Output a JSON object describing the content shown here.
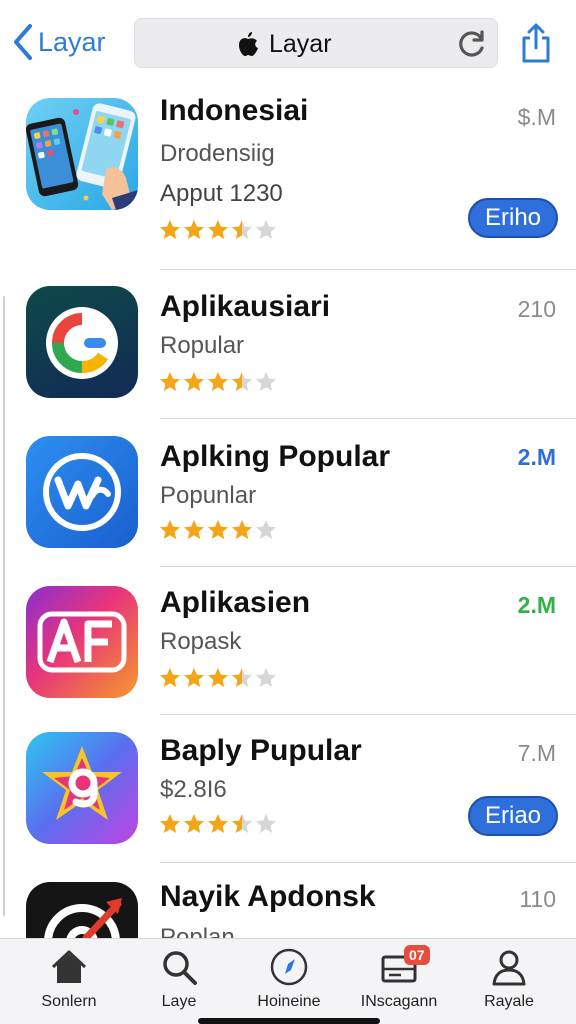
{
  "nav": {
    "back_label": "Layar",
    "address_text": "Layar"
  },
  "apps": [
    {
      "title": "Indonesiai",
      "subtitle": "Drodensiig",
      "subtitle2": "Apput 1230",
      "meta": "$.M",
      "meta_color": "#8a8a8e",
      "rating": 3.5,
      "button": "Eriho"
    },
    {
      "title": "Aplikausiari",
      "subtitle": "Ropular",
      "meta": "210",
      "meta_color": "#8a8a8e",
      "rating": 3.5
    },
    {
      "title": "Aplking Popular",
      "subtitle": "Popunlar",
      "meta": "2.M",
      "meta_color": "#2f6fdc",
      "rating": 4
    },
    {
      "title": "Aplikasien",
      "subtitle": "Ropask",
      "meta": "2.M",
      "meta_color": "#2fb24a",
      "rating": 3.5
    },
    {
      "title": "Baply Pupular",
      "subtitle": "$2.8I6",
      "meta": "7.M",
      "meta_color": "#8a8a8e",
      "rating": 3.5,
      "button": "Eriao"
    },
    {
      "title": "Nayik Apdonsk",
      "subtitle": "Poplan",
      "meta": "110",
      "meta_color": "#8a8a8e",
      "rating": 0
    }
  ],
  "tabs": [
    {
      "label": "Sonlern",
      "icon": "home-icon"
    },
    {
      "label": "Laye",
      "icon": "search-icon"
    },
    {
      "label": "Hoineine",
      "icon": "compass-icon"
    },
    {
      "label": "INscagann",
      "icon": "inbox-icon",
      "badge": "07"
    },
    {
      "label": "Rayale",
      "icon": "person-icon"
    }
  ],
  "colors": {
    "accent": "#2f7bd8",
    "button": "#2f6fdc",
    "star": "#f2a516",
    "star_empty": "#d6d6d6"
  }
}
